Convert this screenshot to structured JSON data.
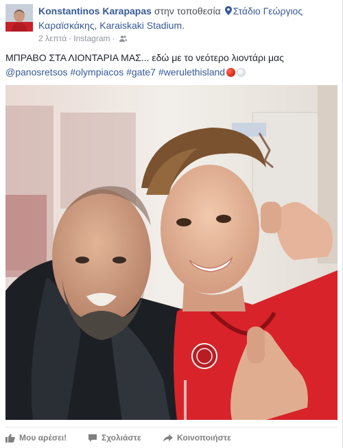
{
  "post": {
    "author": "Konstantinos Karapapas",
    "location_prefix": "στην τοποθεσία",
    "place_line1": "Στάδιο Γεώργιος",
    "place_line2": "Καραϊσκάκης, Karaiskaki Stadium.",
    "time": "2 λεπτά",
    "separator": "·",
    "source": "Instagram",
    "text_line1": "ΜΠΡΑΒΟ ΣΤΑ ΛΙΟΝΤΑΡΙΑ ΜΑΣ... εδώ με το νεότερο λιοντάρι μας",
    "mention": "@panosretsos",
    "hashtags": [
      "#olympiacos",
      "#gate7",
      "#werulethisland"
    ],
    "icons": {
      "location": "location-pin-icon",
      "audience": "friends-audience-icon",
      "emoji1": "red-circle-emoji",
      "emoji2": "white-circle-emoji"
    }
  },
  "actions": {
    "like": "Μου αρέσει!",
    "comment": "Σχολιάστε",
    "share": "Κοινοποιήστε"
  },
  "colors": {
    "link": "#365899",
    "meta": "#90949c",
    "action": "#7f7f7f",
    "jersey_red": "#d8232a"
  }
}
